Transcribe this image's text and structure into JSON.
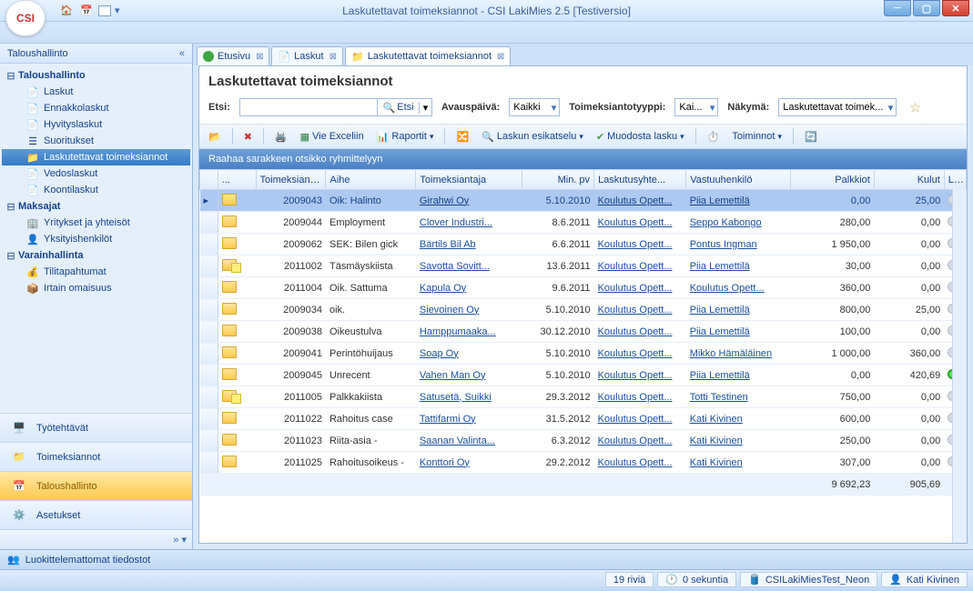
{
  "window": {
    "title": "Laskutettavat toimeksiannot - CSI LakiMies 2.5 [Testiversio]",
    "logo": "CSI"
  },
  "sidebar": {
    "header": "Taloushallinto",
    "groups": [
      {
        "label": "Taloushallinto",
        "items": [
          {
            "label": "Laskut"
          },
          {
            "label": "Ennakkolaskut"
          },
          {
            "label": "Hyvityslaskut"
          },
          {
            "label": "Suoritukset"
          },
          {
            "label": "Laskutettavat toimeksiannot",
            "selected": true
          },
          {
            "label": "Vedoslaskut"
          },
          {
            "label": "Koontilaskut"
          }
        ]
      },
      {
        "label": "Maksajat",
        "items": [
          {
            "label": "Yritykset ja yhteisöt"
          },
          {
            "label": "Yksityishenkilöt"
          }
        ]
      },
      {
        "label": "Varainhallinta",
        "items": [
          {
            "label": "Tilitapahtumat"
          },
          {
            "label": "Irtain omaisuus"
          }
        ]
      }
    ],
    "buttons": [
      {
        "label": "Työtehtävät"
      },
      {
        "label": "Toimeksiannot"
      },
      {
        "label": "Taloushallinto",
        "active": true
      },
      {
        "label": "Asetukset"
      }
    ]
  },
  "tabs": [
    {
      "label": "Etusivu",
      "color": "#3fa544"
    },
    {
      "label": "Laskut",
      "color": "#e6b93a"
    },
    {
      "label": "Laskutettavat toimeksiannot",
      "color": "#e6b93a",
      "active": true
    }
  ],
  "panel": {
    "title": "Laskutettavat toimeksiannot",
    "search": {
      "label": "Etsi:",
      "button": "Etsi",
      "avaus_lbl": "Avauspäivä:",
      "avaus_val": "Kaikki",
      "tyyppi_lbl": "Toimeksiantotyyppi:",
      "tyyppi_val": "Kai...",
      "nakyma_lbl": "Näkymä:",
      "nakyma_val": "Laskutettavat toimek..."
    },
    "toolbar": {
      "excel": "Vie Exceliin",
      "raportit": "Raportit",
      "preview": "Laskun esikatselu",
      "muodosta": "Muodosta lasku",
      "toiminnot": "Toiminnot"
    },
    "groupbar": "Raahaa sarakkeen otsikko ryhmittelyyn",
    "columns": {
      "no": "Toimeksianton...",
      "aihe": "Aihe",
      "ta": "Toimeksiantaja",
      "pv": "Min. pv",
      "ly": "Laskutusyhte...",
      "vh": "Vastuuhenkilö",
      "pk": "Palkkiot",
      "ku": "Kulut",
      "l": "L..."
    },
    "rows": [
      {
        "no": "2009043",
        "aihe": "Oik: Halinto",
        "ta": "Girahwi Oy",
        "pv": "5.10.2010",
        "ly": "Koulutus Opett...",
        "vh": "Piia Lemettilä",
        "pk": "0,00",
        "ku": "25,00",
        "sel": true
      },
      {
        "no": "2009044",
        "aihe": "Employment",
        "ta": "Clover Industri...",
        "pv": "8.6.2011",
        "ly": "Koulutus Opett...",
        "vh": "Seppo Kabongo",
        "pk": "280,00",
        "ku": "0,00"
      },
      {
        "no": "2009062",
        "aihe": "SEK: Bilen gick",
        "ta": "Bärtils Bil Ab",
        "pv": "6.6.2011",
        "ly": "Koulutus Opett...",
        "vh": "Pontus Ingman",
        "pk": "1 950,00",
        "ku": "0,00"
      },
      {
        "no": "2011002",
        "aihe": "Täsmäyskiista",
        "ta": "Savotta Sovitt...",
        "pv": "13.6.2011",
        "ly": "Koulutus Opett...",
        "vh": "Piia Lemettilä",
        "pk": "30,00",
        "ku": "0,00",
        "anno": true
      },
      {
        "no": "2011004",
        "aihe": "Oik. Sattuma",
        "ta": "Kapula Oy",
        "pv": "9.6.2011",
        "ly": "Koulutus Opett...",
        "vh": "Koulutus Opett...",
        "pk": "360,00",
        "ku": "0,00"
      },
      {
        "no": "2009034",
        "aihe": "oik.",
        "ta": "Sievoinen Oy",
        "pv": "5.10.2010",
        "ly": "Koulutus Opett...",
        "vh": "Piia Lemettilä",
        "pk": "800,00",
        "ku": "25,00"
      },
      {
        "no": "2009038",
        "aihe": "Oikeustulva",
        "ta": "Hamppumaaka...",
        "pv": "30.12.2010",
        "ly": "Koulutus Opett...",
        "vh": "Piia Lemettilä",
        "pk": "100,00",
        "ku": "0,00"
      },
      {
        "no": "2009041",
        "aihe": "Perintöhuijaus",
        "ta": "Soap Oy",
        "pv": "5.10.2010",
        "ly": "Koulutus Opett...",
        "vh": "Mikko Hämäläinen",
        "pk": "1 000,00",
        "ku": "360,00"
      },
      {
        "no": "2009045",
        "aihe": "Unrecent",
        "ta": "Vahen Man Oy",
        "pv": "5.10.2010",
        "ly": "Koulutus Opett...",
        "vh": "Piia Lemettilä",
        "pk": "0,00",
        "ku": "420,69",
        "green": true
      },
      {
        "no": "2011005",
        "aihe": "Palkkakiista",
        "ta": "Satusetä, Suikki",
        "pv": "29.3.2012",
        "ly": "Koulutus Opett...",
        "vh": "Totti Testinen",
        "pk": "750,00",
        "ku": "0,00",
        "anno": true
      },
      {
        "no": "2011022",
        "aihe": "Rahoitus case",
        "ta": "Tattifarmi Oy",
        "pv": "31.5.2012",
        "ly": "Koulutus Opett...",
        "vh": "Kati Kivinen",
        "pk": "600,00",
        "ku": "0,00"
      },
      {
        "no": "2011023",
        "aihe": "Riita-asia -",
        "ta": "Saanan Valinta...",
        "pv": "6.3.2012",
        "ly": "Koulutus Opett...",
        "vh": "Kati Kivinen",
        "pk": "250,00",
        "ku": "0,00"
      },
      {
        "no": "2011025",
        "aihe": "Rahoitusoikeus -",
        "ta": "Konttori Oy",
        "pv": "29.2.2012",
        "ly": "Koulutus Opett...",
        "vh": "Kati Kivinen",
        "pk": "307,00",
        "ku": "0,00"
      }
    ],
    "sums": {
      "pk": "9 692,23",
      "ku": "905,69"
    }
  },
  "footer": {
    "label": "Luokittelemattomat tiedostot"
  },
  "status": {
    "rows": "19 riviä",
    "time": "0 sekuntia",
    "db": "CSILakiMiesTest_Neon",
    "user": "Kati Kivinen"
  }
}
